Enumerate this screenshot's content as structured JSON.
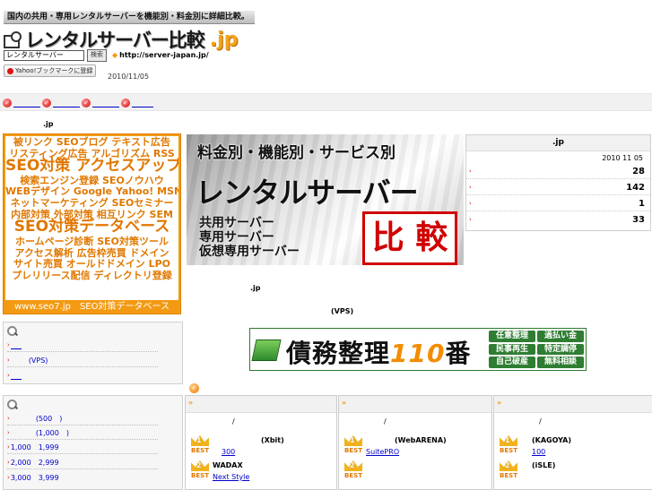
{
  "header": {
    "tagline": "国内の共用・専用レンタルサーバーを機能別・料金別に詳細比較。",
    "logo_text": "レンタルサーバー比較",
    "logo_tld": ".jp",
    "search_value": "レンタルサーバー",
    "search_button": "検索",
    "url": "http://server-japan.jp/",
    "yahoo_bookmark": "Yahoo!ブックマークに登録",
    "date": "2010/11/05"
  },
  "nav": {
    "items": [
      "",
      "",
      "",
      ""
    ]
  },
  "left": {
    "caption": ".jp",
    "seo_lines": [
      {
        "text": "被リンク SEOブログ テキスト広告",
        "size": 11
      },
      {
        "text": "リスティング広告 アルゴリズム RSS",
        "size": 11
      },
      {
        "text": "SEO対策 アクセスアップ",
        "size": 17
      },
      {
        "text": "検索エンジン登録 SEOノウハウ",
        "size": 11
      },
      {
        "text": "WEBデザイン Google Yahoo! MSN",
        "size": 11
      },
      {
        "text": "ネットマーケティング SEOセミナー",
        "size": 11
      },
      {
        "text": "内部対策 外部対策 相互リンク SEM",
        "size": 11
      },
      {
        "text": "SEO対策データベース",
        "size": 17
      },
      {
        "text": "ホームページ診断 SEO対策ツール",
        "size": 11
      },
      {
        "text": "アクセス解析 広告枠売買 ドメイン",
        "size": 11
      },
      {
        "text": "サイト売買 オールドドメイン LPO",
        "size": 11
      },
      {
        "text": "プレリリース配信 ディレクトリ登録",
        "size": 11
      }
    ],
    "seo_footer": "www.seo7.jp　SEO対策データベース",
    "panel1_links": [
      "",
      "(VPS)",
      ""
    ],
    "panel2_links": [
      "(500　)",
      "(1,000　)",
      "1,000　1,999",
      "2,000　2,999",
      "3,000　3,999"
    ]
  },
  "banner": {
    "line1": "料金別・機能別・サービス別",
    "line2": "レンタルサーバー",
    "small_lines": [
      "共用サーバー",
      "専用サーバー",
      "仮想専用サーバー"
    ],
    "hikaku": "比 較"
  },
  "center": {
    "text1": ".jp",
    "text2": "(VPS)"
  },
  "debt": {
    "title": "債務整理",
    "number": "110",
    "suffix": "番",
    "tags": [
      "任意整理",
      "過払い金",
      "民事再生",
      "特定調停",
      "自己破産",
      "無料相談"
    ]
  },
  "info": {
    "title": ".jp",
    "date": "2010 11 05",
    "values": [
      "28",
      "142",
      "1",
      "33"
    ]
  },
  "ranking": {
    "columns": [
      {
        "slash": "/",
        "first_provider": "(Xbit)",
        "first_link": "300",
        "second_provider": "WADAX",
        "second_link": "Next Style"
      },
      {
        "slash": "/",
        "first_provider": "(WebARENA)",
        "first_link": "SuitePRO",
        "second_provider": "",
        "second_link": ""
      },
      {
        "slash": "/",
        "first_provider": "(KAGOYA)",
        "first_link": "100",
        "second_provider": "(iSLE)",
        "second_link": ""
      }
    ],
    "best_label": "BEST",
    "head_mark": "»"
  }
}
